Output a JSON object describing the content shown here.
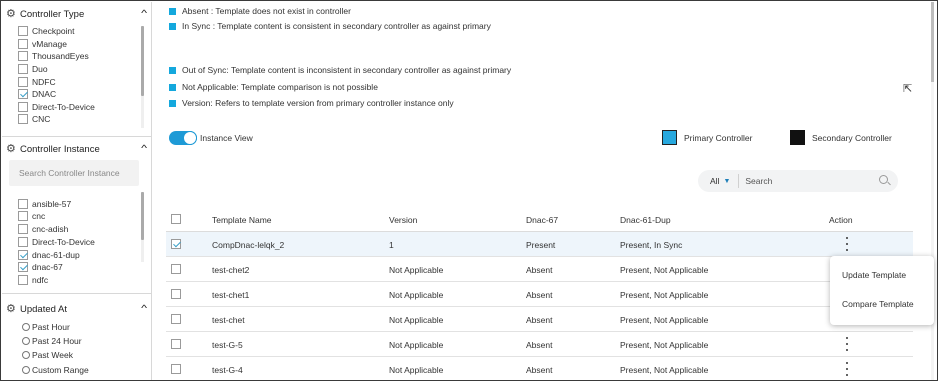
{
  "sidebar": {
    "controller_type": {
      "title": "Controller Type",
      "items": [
        {
          "label": "Checkpoint",
          "checked": false
        },
        {
          "label": "vManage",
          "checked": false
        },
        {
          "label": "ThousandEyes",
          "checked": false
        },
        {
          "label": "Duo",
          "checked": false
        },
        {
          "label": "NDFC",
          "checked": false
        },
        {
          "label": "DNAC",
          "checked": true
        },
        {
          "label": "Direct-To-Device",
          "checked": false
        },
        {
          "label": "CNC",
          "checked": false
        }
      ]
    },
    "controller_instance": {
      "title": "Controller Instance",
      "search_placeholder": "Search Controller Instance",
      "items": [
        {
          "label": "ansible-57",
          "checked": false
        },
        {
          "label": "cnc",
          "checked": false
        },
        {
          "label": "cnc-adish",
          "checked": false
        },
        {
          "label": "Direct-To-Device",
          "checked": false
        },
        {
          "label": "dnac-61-dup",
          "checked": true
        },
        {
          "label": "dnac-67",
          "checked": true
        },
        {
          "label": "ndfc",
          "checked": false
        }
      ]
    },
    "updated_at": {
      "title": "Updated At",
      "options": [
        "Past Hour",
        "Past 24 Hour",
        "Past Week",
        "Custom Range"
      ]
    }
  },
  "legend": {
    "lines": [
      "Absent : Template does not exist in controller",
      "In Sync : Template content is consistent in secondary controller as against primary",
      "Out of Sync: Template content is inconsistent in secondary controller as against primary",
      "Not Applicable: Template comparison is not possible",
      "Version: Refers to template version from primary controller instance only"
    ],
    "color": "#14a8dd"
  },
  "view": {
    "instance_view_label": "Instance View",
    "primary_label": "Primary Controller",
    "secondary_label": "Secondary Controller",
    "primary_color": "#27a8de",
    "secondary_color": "#111111"
  },
  "filter": {
    "scope": "All",
    "search_placeholder": "Search"
  },
  "table": {
    "headers": {
      "name": "Template Name",
      "version": "Version",
      "dnac67": "Dnac-67",
      "dnac61": "Dnac-61-Dup",
      "action": "Action"
    },
    "rows": [
      {
        "name": "CompDnac-lelqk_2",
        "version": "1",
        "dnac67": "Present",
        "dnac61": "Present, In Sync",
        "selected": true
      },
      {
        "name": "test-chet2",
        "version": "Not Applicable",
        "dnac67": "Absent",
        "dnac61": "Present, Not Applicable",
        "selected": false
      },
      {
        "name": "test-chet1",
        "version": "Not Applicable",
        "dnac67": "Absent",
        "dnac61": "Present, Not Applicable",
        "selected": false
      },
      {
        "name": "test-chet",
        "version": "Not Applicable",
        "dnac67": "Absent",
        "dnac61": "Present, Not Applicable",
        "selected": false
      },
      {
        "name": "test-G-5",
        "version": "Not Applicable",
        "dnac67": "Absent",
        "dnac61": "Present, Not Applicable",
        "selected": false
      },
      {
        "name": "test-G-4",
        "version": "Not Applicable",
        "dnac67": "Absent",
        "dnac61": "Present, Not Applicable",
        "selected": false
      }
    ]
  },
  "action_menu": {
    "items": [
      "Update Template",
      "Compare Template"
    ]
  }
}
